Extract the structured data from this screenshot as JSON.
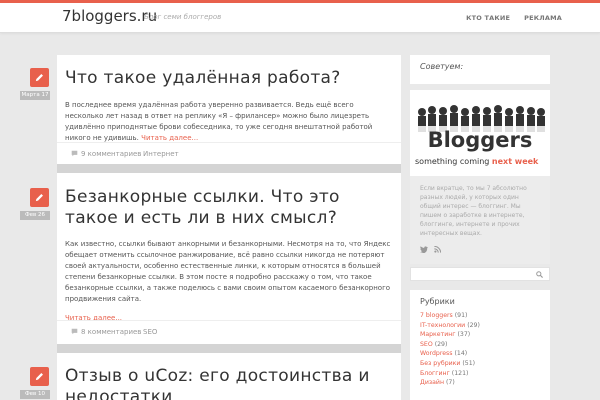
{
  "header": {
    "logo": "7bloggers.ru",
    "tagline": "Блог семи блоггеров",
    "nav": [
      "Кто такие",
      "Реклама"
    ]
  },
  "posts": [
    {
      "date": "Марта 17",
      "title": "Что такое удалённая работа?",
      "excerpt": "В последнее время удалённая работа уверенно развивается. Ведь ещё всего несколько лет назад в ответ на реплику «Я – фрилансер» можно было лицезреть удивлённо приподнятые брови собеседника, то уже сегодня внештатной работой никого не удивишь.",
      "more": "Читать далее...",
      "comments": "9 комментариев",
      "category": "Интернет"
    },
    {
      "date": "Фев 26",
      "title": "Безанкорные ссылки. Что это такое и есть ли в них смысл?",
      "excerpt": "Как известно, ссылки бывают анкорными и безанкорными. Несмотря на то, что Яндекс обещает отменить ссылочное ранжирование, всё равно ссылки никогда не потеряют своей актуальности, особенно естественные линки, к которым относятся в большей степени безанкорные ссылки. В этом посте я подробно расскажу о том, что такое безанкорные ссылки, а также поделюсь с вами своим опытом касаемого безанкорного продвижения сайта.",
      "more": "Читать далее...",
      "comments": "8 комментариев",
      "category": "SEO"
    },
    {
      "date": "Фев 10",
      "title": "Отзыв о uCoz: его достоинства и недостатки"
    }
  ],
  "sidebar": {
    "advice_title": "Советуем:",
    "banner_text": "Bloggers",
    "banner_caption_1": "something coming ",
    "banner_caption_2": "next week",
    "about": "Если вкратце, то мы 7 абсолютно разных людей, у которых один общий интерес — блоггинг. Мы пишем о заработке в интернете, блоггинге, интернете и прочих интересных вещах.",
    "rubrics_title": "Рубрики",
    "categories": [
      {
        "name": "7 bloggers",
        "count": "(91)"
      },
      {
        "name": "IT-технологии",
        "count": "(29)"
      },
      {
        "name": "Маркетинг",
        "count": "(37)"
      },
      {
        "name": "SEO",
        "count": "(29)"
      },
      {
        "name": "Wordpress",
        "count": "(14)"
      },
      {
        "name": "Без рубрики",
        "count": "(51)"
      },
      {
        "name": "Блоггинг",
        "count": "(121)"
      },
      {
        "name": "Дизайн",
        "count": "(7)"
      }
    ]
  },
  "colors": {
    "accent": "#e8604c"
  }
}
